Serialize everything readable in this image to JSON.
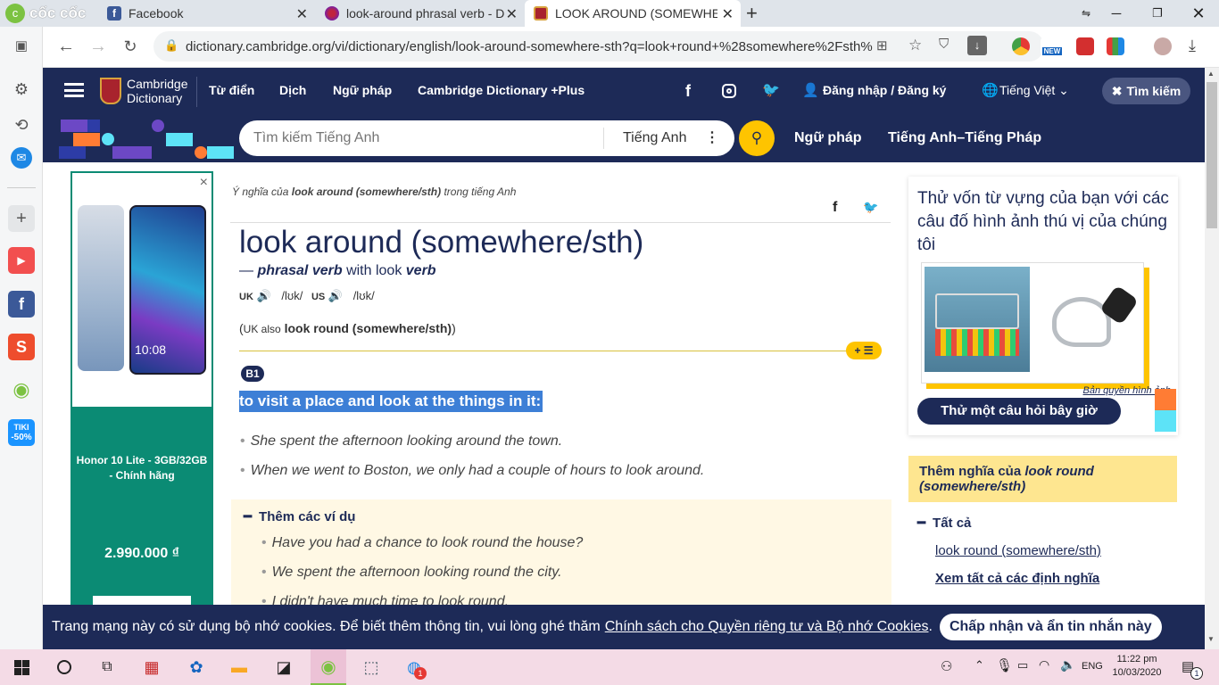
{
  "browser": {
    "brand": "cốc cốc",
    "tabs": [
      {
        "title": "Facebook",
        "icon": "facebook-icon"
      },
      {
        "title": "look-around phrasal verb - Dict",
        "icon": "opera-icon"
      },
      {
        "title": "LOOK AROUND (SOMEWHER",
        "icon": "cambridge-icon"
      }
    ],
    "new_tab": "+",
    "url": "dictionary.cambridge.org/vi/dictionary/english/look-around-somewhere-sth?q=look+round+%28somewhere%2Fsth%29",
    "ext_badge": "NEW"
  },
  "site": {
    "logo_line1": "Cambridge",
    "logo_line2": "Dictionary",
    "menu": [
      "Từ điển",
      "Dịch",
      "Ngữ pháp",
      "Cambridge Dictionary +Plus"
    ],
    "login": "Đăng nhập / Đăng ký",
    "language": "Tiếng Việt",
    "search_toggle": "Tìm kiếm",
    "search_placeholder": "Tìm kiếm Tiếng Anh",
    "search_lang": "Tiếng Anh",
    "sub_links": [
      "Ngữ pháp",
      "Tiếng Anh–Tiếng Pháp"
    ]
  },
  "ad": {
    "phone_time": "10:08",
    "title": "Honor 10 Lite - 3GB/32GB - Chính hãng",
    "price": "2.990.000 ₫",
    "close": "×"
  },
  "entry": {
    "meaning_prefix": "Ý nghĩa của",
    "meaning_term": "look around (somewhere/sth)",
    "meaning_suffix": "trong tiếng Anh",
    "headword": "look around (somewhere/sth)",
    "pos_dash": "—",
    "pos": "phrasal verb",
    "with_text": "with look",
    "with_pos": "verb",
    "uk_label": "UK",
    "us_label": "US",
    "uk_ipa": "/lʊk/",
    "us_ipa": "/lʊk/",
    "also_open": "(",
    "also_region": "UK also",
    "also_term": "look round (somewhere/sth)",
    "also_close": ")",
    "level": "B1",
    "definition": "to visit a place and look at the things in it:",
    "examples": [
      "She spent the afternoon looking around the town.",
      "When we went to Boston, we only had a couple of hours to look around."
    ],
    "more_label": "Thêm các ví dụ",
    "more_examples": [
      "Have you had a chance to look round the house?",
      "We spent the afternoon looking round the city.",
      "I didn't have much time to look round."
    ],
    "plus_list": "+"
  },
  "quiz": {
    "heading": "Thử vốn từ vựng của bạn với các câu đố hình ảnh thú vị của chúng tôi",
    "copyright": "Bản quyền hình ảnh",
    "button": "Thử một câu hỏi bây giờ"
  },
  "more_meanings": {
    "prefix": "Thêm nghĩa của",
    "term": "look round (somewhere/sth)",
    "all_label": "Tất cả",
    "link": "look round (somewhere/sth)",
    "see_all": "Xem tất cả các định nghĩa"
  },
  "cookie": {
    "text": "Trang mạng này có sử dụng bộ nhớ cookies. Để biết thêm thông tin, vui lòng ghé thăm",
    "link": "Chính sách cho Quyền riêng tư và Bộ nhớ Cookies",
    "end": ".",
    "button": "Chấp nhận và ẩn tin nhắn này"
  },
  "taskbar": {
    "lang": "ENG",
    "time": "11:22 pm",
    "date": "10/03/2020",
    "zalo_badge": "1",
    "notif_badge": "1"
  },
  "sidebar_badges": {
    "tiki": "TIKI",
    "tiki_discount": "-50%"
  },
  "colors": {
    "brand_navy": "#1d2a57",
    "accent_yellow": "#fec400",
    "ad_green": "#0b8b74",
    "highlight": "#3d7fd6",
    "more_examples_bg": "#fff8e4"
  }
}
